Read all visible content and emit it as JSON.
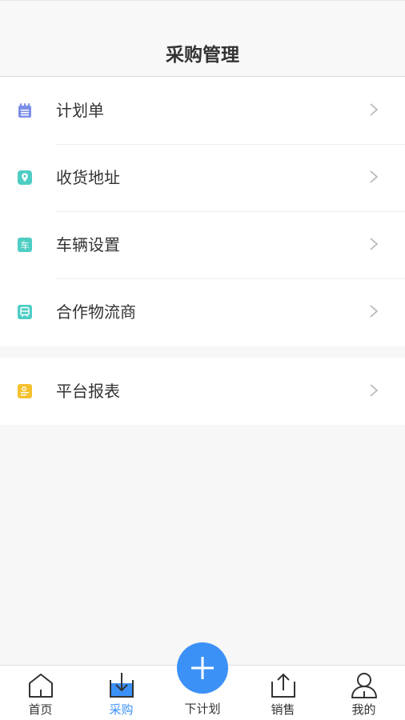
{
  "header": {
    "title": "采购管理"
  },
  "menu": {
    "group1": [
      {
        "label": "计划单",
        "icon": "notepad-icon",
        "color": "#7b8ee8"
      },
      {
        "label": "收货地址",
        "icon": "location-pin-icon",
        "color": "#4ecdc4"
      },
      {
        "label": "车辆设置",
        "icon": "car-char-icon",
        "color": "#4ecdc4",
        "icon_text": "车"
      },
      {
        "label": "合作物流商",
        "icon": "bus-icon",
        "color": "#4ecdc4"
      }
    ],
    "group2": [
      {
        "label": "平台报表",
        "icon": "report-icon",
        "color": "#f5c12e"
      }
    ]
  },
  "tabbar": {
    "tabs": [
      {
        "label": "首页",
        "icon": "home-icon",
        "active": false
      },
      {
        "label": "采购",
        "icon": "download-tray-icon",
        "active": true
      },
      {
        "label": "下计划",
        "icon": "plus-icon",
        "active": false
      },
      {
        "label": "销售",
        "icon": "upload-tray-icon",
        "active": false
      },
      {
        "label": "我的",
        "icon": "user-icon",
        "active": false
      }
    ],
    "active_color": "#3c91f7"
  }
}
